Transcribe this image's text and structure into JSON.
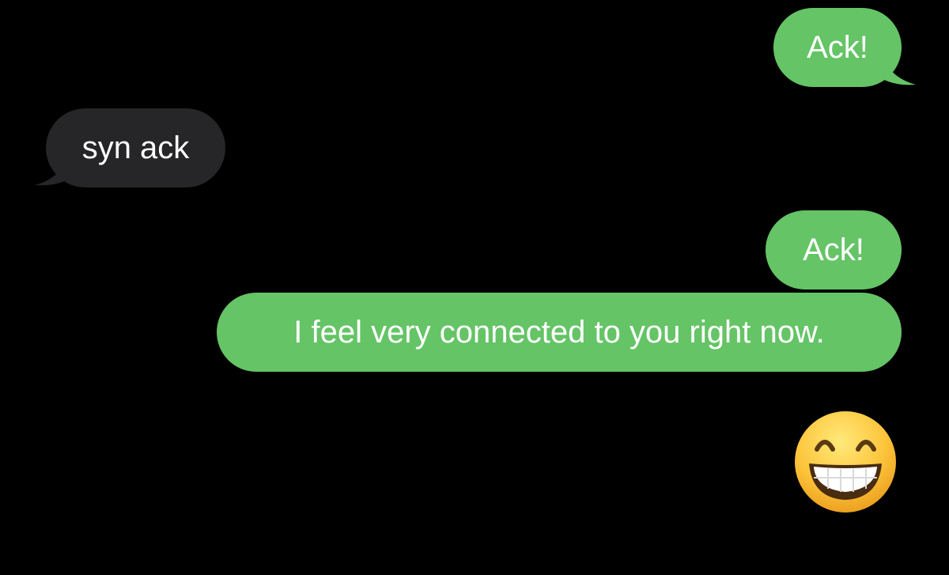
{
  "conversation": {
    "messages": [
      {
        "direction": "sent",
        "text": "Ack!"
      },
      {
        "direction": "received",
        "text": "syn ack"
      },
      {
        "direction": "sent",
        "text": "Ack!"
      },
      {
        "direction": "sent",
        "text": "I feel very connected to you right now."
      },
      {
        "direction": "sent",
        "emoji": "grinning-face-with-smiling-eyes-icon"
      }
    ]
  },
  "colors": {
    "background": "#000000",
    "sent_bubble": "#65c466",
    "received_bubble": "#262628",
    "text": "#ffffff"
  }
}
